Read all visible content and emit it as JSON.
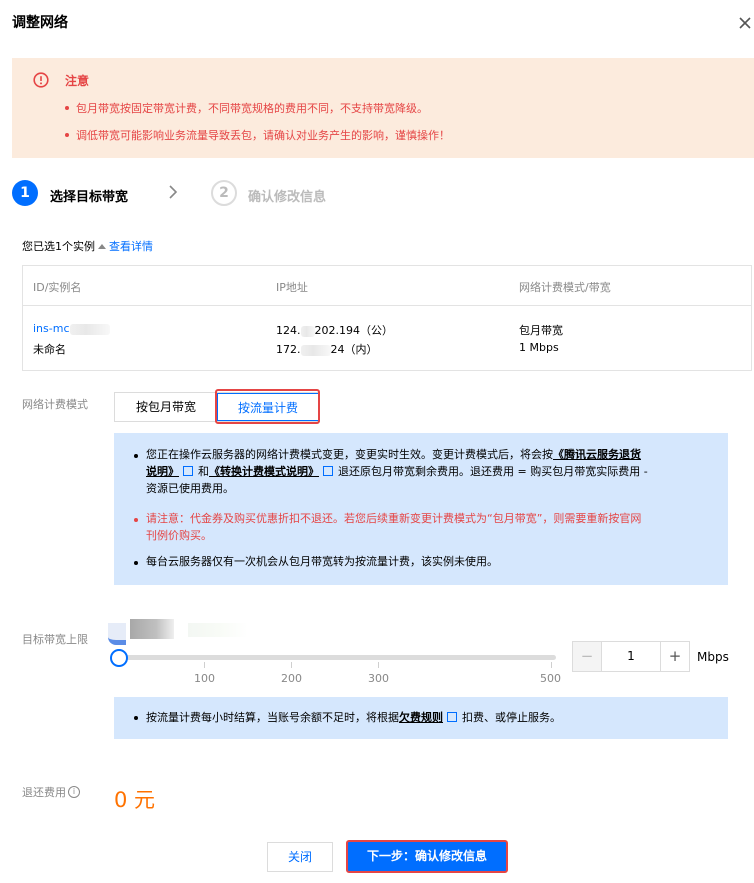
{
  "dialog": {
    "title": "调整网络"
  },
  "notice": {
    "title": "注意",
    "items": [
      "包月带宽按固定带宽计费，不同带宽规格的费用不同，不支持带宽降级。",
      "调低带宽可能影响业务流量导致丢包，请确认对业务产生的影响，谨慎操作！"
    ]
  },
  "steps": [
    {
      "number": "1",
      "label": "选择目标带宽"
    },
    {
      "number": "2",
      "label": "确认修改信息"
    }
  ],
  "selection": {
    "text": "您已选1个实例",
    "link": "查看详情"
  },
  "table": {
    "headers": [
      "ID/实例名",
      "IP地址",
      "网络计费模式/带宽"
    ],
    "row": {
      "id": "ins-mc",
      "name": "未命名",
      "ip_public_a": "124.",
      "ip_public_b": "202.194（公）",
      "ip_private_a": "172.",
      "ip_private_b": "24（内）",
      "billing_mode": "包月带宽",
      "bandwidth": "1 Mbps"
    }
  },
  "billing": {
    "label": "网络计费模式",
    "options": [
      "按包月带宽",
      "按流量计费"
    ],
    "selected": "按流量计费"
  },
  "info1": {
    "l1_a": "您正在操作云服务器的网络计费模式变更，变更实时生效。变更计费模式后，将会按",
    "l1_link": "《腾讯云服务退货",
    "l2_link_end": "说明》",
    "l2_and": "和",
    "l2_link2": "《转换计费模式说明》",
    "l2_b": "退还原包月带宽剩余费用。退还费用 = 购买包月带宽实际费用 -",
    "l3": "资源已使用费用。",
    "red_l1": "请注意：代金券及购买优惠折扣不退还。若您后续重新变更计费模式为“包月带宽”，则需要重新按官网",
    "red_l2": "刊例价购买。",
    "l4": "每台云服务器仅有一次机会从包月带宽转为按流量计费，该实例未使用。"
  },
  "bandwidth": {
    "label": "目标带宽上限",
    "value": "1",
    "unit": "Mbps",
    "min": 1,
    "max": 500,
    "ticks": [
      "100",
      "200",
      "300",
      "500"
    ]
  },
  "info2": {
    "a": "按流量计费每小时结算，当账号余额不足时，将根据",
    "link": "欠费规则",
    "b": "扣费、或停止服务。"
  },
  "refund": {
    "label": "退还费用",
    "value": "0 元"
  },
  "footer": {
    "close": "关闭",
    "next": "下一步：确认修改信息"
  },
  "colors": {
    "primary": "#006eff",
    "warning_bg": "#fcebdd",
    "warning_text": "#e54545",
    "info_bg": "#d5e7fd",
    "refund": "#ff7200"
  }
}
